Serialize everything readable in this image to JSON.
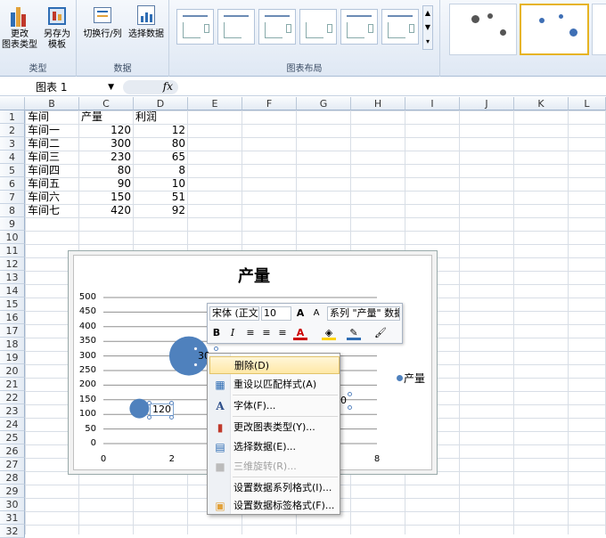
{
  "ribbon": {
    "type_group": {
      "label": "类型",
      "change_type": "更改\n图表类型",
      "save_template": "另存为\n模板"
    },
    "data_group": {
      "label": "数据",
      "switch_row_col": "切换行/列",
      "select_data": "选择数据"
    },
    "layout_group": {
      "label": "图表布局"
    }
  },
  "formula_bar": {
    "name_box": "图表 1",
    "fx": "fx"
  },
  "columns": [
    "B",
    "C",
    "D",
    "E",
    "F",
    "G",
    "H",
    "I",
    "J",
    "K",
    "L"
  ],
  "rows": [
    "1",
    "2",
    "3",
    "4",
    "5",
    "6",
    "7",
    "8",
    "9",
    "10",
    "11",
    "12",
    "13",
    "14",
    "15",
    "16",
    "17",
    "18",
    "19",
    "20",
    "21",
    "22",
    "23",
    "24",
    "25",
    "26",
    "27",
    "28",
    "29",
    "30",
    "31",
    "32"
  ],
  "sheet": {
    "header": [
      "车间",
      "产量",
      "利润"
    ],
    "data": [
      [
        "车间一",
        "120",
        "12"
      ],
      [
        "车间二",
        "300",
        "80"
      ],
      [
        "车间三",
        "230",
        "65"
      ],
      [
        "车间四",
        "80",
        "8"
      ],
      [
        "车间五",
        "90",
        "10"
      ],
      [
        "车间六",
        "150",
        "51"
      ],
      [
        "车间七",
        "420",
        "92"
      ]
    ]
  },
  "chart": {
    "title": "产量",
    "legend": "产量",
    "label_120": "120",
    "label_30": "30",
    "label_0": "0"
  },
  "chart_data": {
    "type": "scatter",
    "title": "产量",
    "yticks": [
      "500",
      "450",
      "400",
      "350",
      "300",
      "250",
      "200",
      "150",
      "100",
      "50",
      "0"
    ],
    "xticks": [
      "0",
      "2",
      "8"
    ],
    "ylim": [
      0,
      500
    ],
    "series": [
      {
        "name": "产量",
        "x": [
          1,
          2,
          3
        ],
        "y": [
          120,
          300,
          230
        ],
        "size": [
          12,
          80,
          65
        ]
      }
    ],
    "legend_position": "right",
    "grid": true
  },
  "mini_toolbar": {
    "font": "宋体 (正文",
    "size": "10",
    "grow": "A",
    "shrink": "A",
    "series": "系列 \"产量\" 数据",
    "bold": "B",
    "italic": "I"
  },
  "context_menu": {
    "delete": "删除(D)",
    "reset": "重设以匹配样式(A)",
    "font": "字体(F)...",
    "change_chart_type": "更改图表类型(Y)...",
    "select_data": "选择数据(E)...",
    "rotate_3d": "三维旋转(R)...",
    "format_series": "设置数据系列格式(I)...",
    "format_labels": "设置数据标签格式(F)..."
  }
}
